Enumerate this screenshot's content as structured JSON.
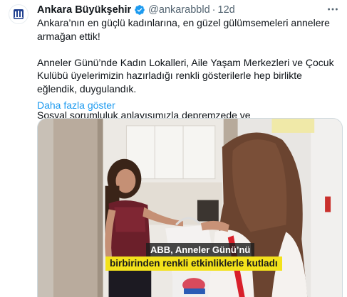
{
  "account": {
    "name": "Ankara Büyükşehir",
    "handle": "@ankarabbld",
    "separator": "·",
    "time": "12d",
    "verified_icon": "verified-badge-icon",
    "avatar_icon": "ankara-logo-icon"
  },
  "tweet": {
    "line1": "Ankara’nın en güçlü kadınlarına, en güzel gülümsemeleri annelere armağan ettik!",
    "line2": "Anneler Günü’nde Kadın Lokalleri, Aile Yaşam Merkezleri ve Çocuk Kulübü üyelerimizin hazırladığı renkli gösterilerle hep birlikte eğlendik, duygulandık.",
    "line3": "Sosyal sorumluluk anlayışımızla depremzede ve",
    "show_more": "Daha fazla göster"
  },
  "media": {
    "caption_top": "ABB, Anneler Günü’nü",
    "caption_bottom": "birbirinden renkli etkinliklerle kutladı"
  },
  "colors": {
    "link": "#1d9bf0",
    "verified": "#1d9bf0",
    "muted": "#536471",
    "caption_highlight": "#f3e21b"
  }
}
